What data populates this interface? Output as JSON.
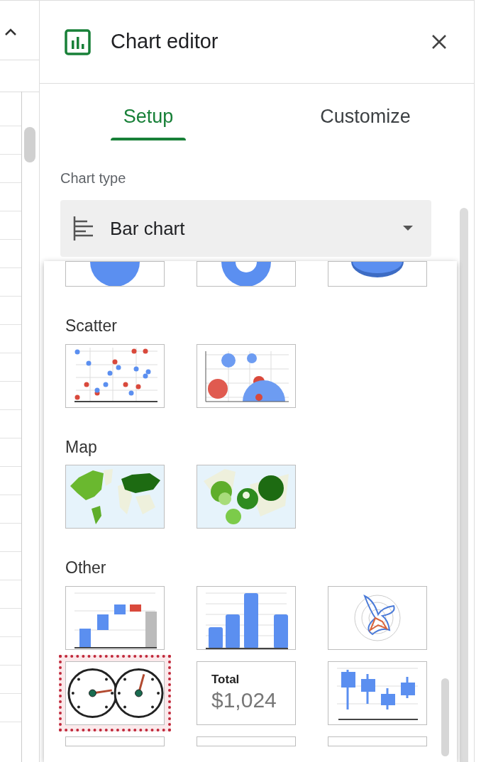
{
  "editor": {
    "title": "Chart editor"
  },
  "tabs": [
    {
      "label": "Setup",
      "selected": true
    },
    {
      "label": "Customize",
      "selected": false
    }
  ],
  "chart_type": {
    "label": "Chart type",
    "value": "Bar chart"
  },
  "menu": {
    "sections": [
      {
        "items": [
          {
            "kind": "pie",
            "selected": false
          },
          {
            "kind": "donut",
            "selected": false
          },
          {
            "kind": "pie3d",
            "selected": false
          }
        ]
      },
      {
        "title": "Scatter",
        "items": [
          {
            "kind": "scatter",
            "selected": false
          },
          {
            "kind": "bubble",
            "selected": false
          }
        ]
      },
      {
        "title": "Map",
        "items": [
          {
            "kind": "geo",
            "selected": false
          },
          {
            "kind": "geo_markers",
            "selected": false
          }
        ]
      },
      {
        "title": "Other",
        "items": [
          {
            "kind": "waterfall",
            "selected": false
          },
          {
            "kind": "histogram",
            "selected": false
          },
          {
            "kind": "radar",
            "selected": false
          },
          {
            "kind": "gauge",
            "selected": true
          },
          {
            "kind": "scorecard",
            "selected": false,
            "title": "Total",
            "value": "$1,024"
          },
          {
            "kind": "candlestick",
            "selected": false
          },
          {
            "kind": "cut"
          },
          {
            "kind": "cut"
          },
          {
            "kind": "cut"
          }
        ]
      }
    ]
  }
}
